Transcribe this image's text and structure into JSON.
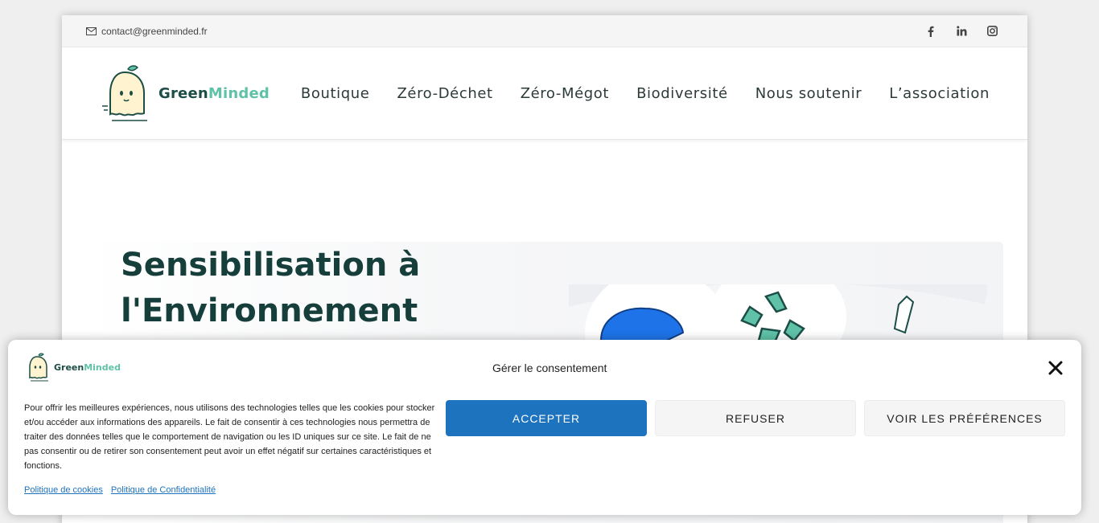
{
  "topbar": {
    "email": "contact@greenminded.fr",
    "socials": [
      {
        "icon": "facebook-icon",
        "label": "f"
      },
      {
        "icon": "linkedin-icon",
        "label": "in"
      },
      {
        "icon": "instagram-icon",
        "label": ""
      }
    ]
  },
  "header": {
    "logo": {
      "part1": "Green",
      "part2": "Minded"
    },
    "nav": [
      "Boutique",
      "Zéro-Déchet",
      "Zéro-Mégot",
      "Biodiversité",
      "Nous soutenir",
      "L’association"
    ]
  },
  "hero": {
    "title_line1": "Sensibilisation à",
    "title_line2": "l'Environnement"
  },
  "consent": {
    "logo": {
      "part1": "Green",
      "part2": "Minded"
    },
    "title": "Gérer le consentement",
    "text": "Pour offrir les meilleures expériences, nous utilisons des technologies telles que les cookies pour stocker et/ou accéder aux informations des appareils. Le fait de consentir à ces technologies nous permettra de traiter des données telles que le comportement de navigation ou les ID uniques sur ce site. Le fait de ne pas consentir ou de retirer son consentement peut avoir un effet négatif sur certaines caractéristiques et fonctions.",
    "accept": "ACCEPTER",
    "refuse": "REFUSER",
    "preferences": "VOIR LES PRÉFÉRENCES",
    "links": [
      "Politique de cookies",
      "Politique de Confidentialité"
    ]
  },
  "colors": {
    "brand_dark": "#1c4d46",
    "brand_light": "#5fc2a7",
    "accept_blue": "#1e73be"
  }
}
